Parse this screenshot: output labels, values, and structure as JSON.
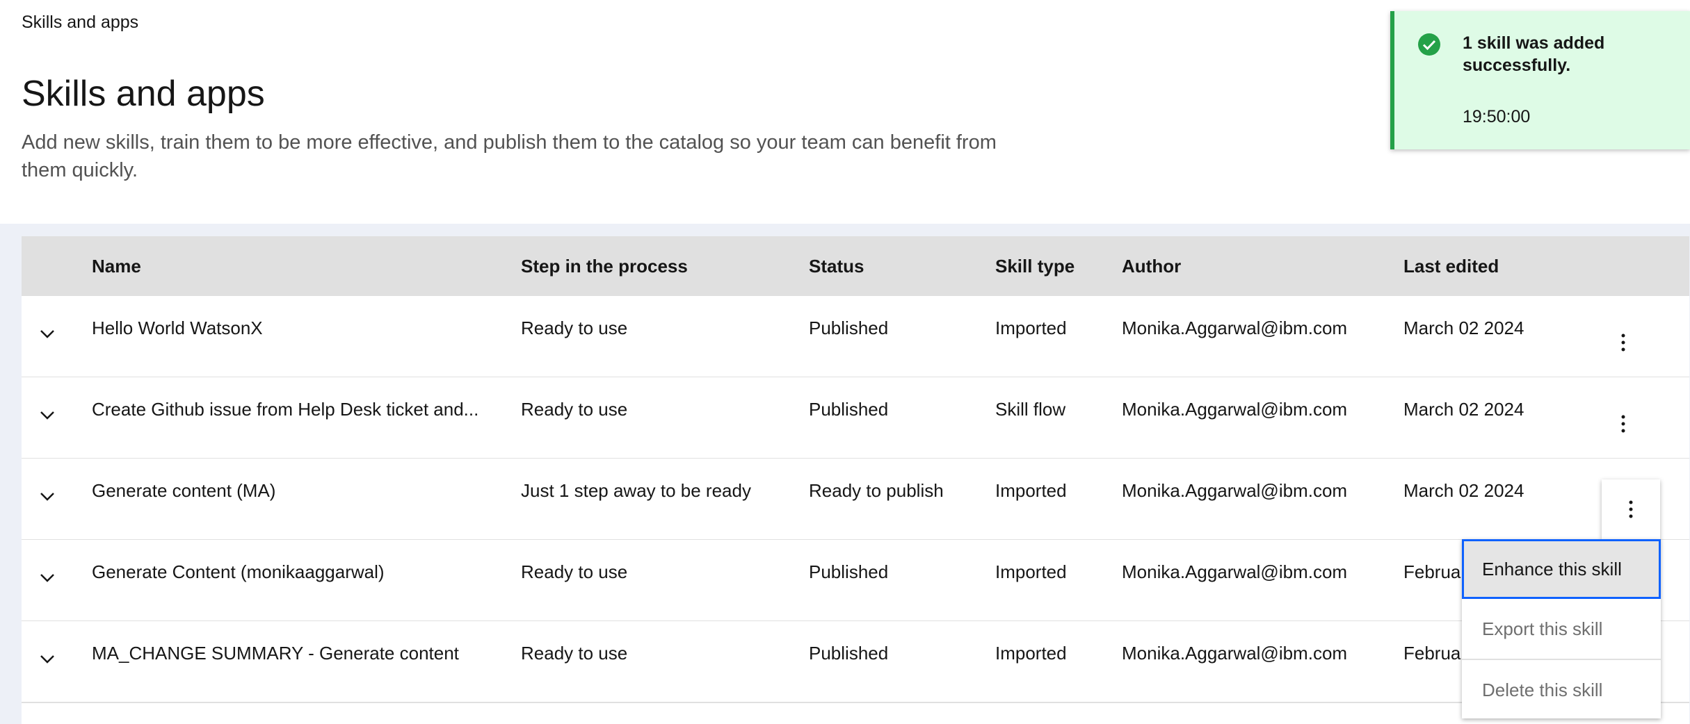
{
  "breadcrumb": "Skills and apps",
  "page": {
    "title": "Skills and apps",
    "description": "Add new skills, train them to be more effective, and publish them to the catalog so your team can benefit from them quickly."
  },
  "table": {
    "headers": {
      "name": "Name",
      "step": "Step in the process",
      "status": "Status",
      "type": "Skill type",
      "author": "Author",
      "edited": "Last edited"
    },
    "rows": [
      {
        "name": "Hello World WatsonX",
        "step": "Ready to use",
        "status": "Published",
        "type": "Imported",
        "author": "Monika.Aggarwal@ibm.com",
        "edited": "March 02 2024"
      },
      {
        "name": "Create Github issue from Help Desk ticket and...",
        "step": "Ready to use",
        "status": "Published",
        "type": "Skill flow",
        "author": "Monika.Aggarwal@ibm.com",
        "edited": "March 02 2024"
      },
      {
        "name": "Generate content (MA)",
        "step": "Just 1 step away to be ready",
        "status": "Ready to publish",
        "type": "Imported",
        "author": "Monika.Aggarwal@ibm.com",
        "edited": "March 02 2024"
      },
      {
        "name": "Generate Content (monikaaggarwal)",
        "step": "Ready to use",
        "status": "Published",
        "type": "Imported",
        "author": "Monika.Aggarwal@ibm.com",
        "edited": "Februa"
      },
      {
        "name": "MA_CHANGE SUMMARY - Generate content",
        "step": "Ready to use",
        "status": "Published",
        "type": "Imported",
        "author": "Monika.Aggarwal@ibm.com",
        "edited": "Februa"
      }
    ]
  },
  "overflow_menu": {
    "items": [
      "Enhance this skill",
      "Export this skill",
      "Delete this skill"
    ]
  },
  "toast": {
    "title": "1 skill was added successfully.",
    "time": "19:50:00"
  },
  "colors": {
    "success_green": "#24a148",
    "toast_bg": "#defbe6",
    "focus_blue": "#0f62fe",
    "header_bg": "#e0e0e0"
  }
}
